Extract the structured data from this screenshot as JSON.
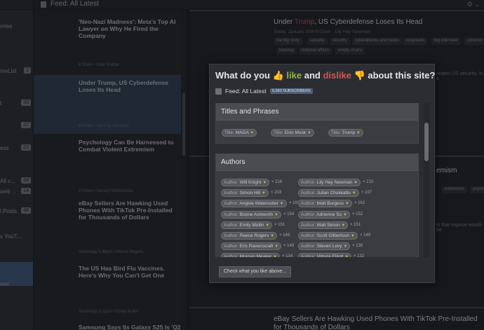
{
  "feed": {
    "title": "Feed: All Latest"
  },
  "sidebar": {
    "items": [
      {
        "label": "ories",
        "count": ""
      },
      {
        "label": "meList",
        "count": "2"
      },
      {
        "label": "t",
        "count": "33"
      },
      {
        "label": "",
        "count": "27"
      },
      {
        "label": "ess",
        "count": "22"
      },
      {
        "label": "All c...",
        "count": "34"
      },
      {
        "label": "web ...",
        "count": "14"
      },
      {
        "label": "l Posts",
        "count": "46"
      },
      {
        "label": "s YouT...",
        "count": ""
      },
      {
        "label": "ries",
        "count": ""
      }
    ]
  },
  "stories": [
    {
      "title": "'Neo-Nazi Madness': Meta's Top AI Lawyer on Why He Fired the Company",
      "meta": "6:20am • Kate Knibbe"
    },
    {
      "title": "Under Trump, US Cyberdefense Loses Its Head",
      "meta": "6:00am • Lily Hay Newman"
    },
    {
      "title": "Psychology Can Be Harnessed to Combat Violent Extremism",
      "meta": "6:00am • Harvey Whitehouse"
    },
    {
      "title": "eBay Sellers Are Hawking Used Phones With TikTok Pre-Installed for Thousands of Dollars",
      "meta": "Yesterday 5:46pm • Reece Rogers"
    },
    {
      "title": "The US Has Bird Flu Vaccines. Here's Why You Can't Get One",
      "meta": "Yesterday 2:11pm • Emily Mullin"
    },
    {
      "title": "Samsung Says Its Galaxy S25 Is 'Q2",
      "meta": ""
    }
  ],
  "pane": {
    "title_pre": "Under ",
    "title_red": "Trump",
    "title_post": ", US Cyberdefense Loses Its Head",
    "meta": "Today, January 20th 6:00am · Lily Hay Newman",
    "tags": [
      "the big story",
      "security",
      "security",
      "cyberattacks and hacks",
      "longreads",
      "big interview",
      "cyberse",
      "hacking",
      "national affairs",
      "empty chairs"
    ],
    "text1": "reaten US security. In a",
    "story2_suffix": "emism",
    "story2_tags": [
      "extremism",
      "psych"
    ],
    "text2": "ts that expose would-be",
    "story3_title": "eBay Sellers Are Hawking Used Phones With TikTok Pre-Installed for Thousands of Dollars"
  },
  "modal": {
    "title_1": "What do you ",
    "title_like": "like",
    "title_and": " and ",
    "title_dislike": "dislike",
    "title_2": " about this site?",
    "feed_name": "Feed: All Latest",
    "subscribers": "5,583 SUBSCRIBERS",
    "section_titles": "Titles and Phrases",
    "section_authors": "Authors",
    "titles": [
      {
        "key": "Title:",
        "value": "MAGA"
      },
      {
        "key": "Title:",
        "value": "Elon Musk"
      },
      {
        "key": "Title:",
        "value": "Trump"
      }
    ],
    "authors": [
      {
        "key": "Author:",
        "value": "Will Knight",
        "count": "× 216"
      },
      {
        "key": "Author:",
        "value": "Lily Hay Newman",
        "count": "× 210"
      },
      {
        "key": "Author:",
        "value": "Simon Hill",
        "count": "× 203"
      },
      {
        "key": "Author:",
        "value": "Julian Chokkattu",
        "count": "× 197"
      },
      {
        "key": "Author:",
        "value": "Angela Watercutter",
        "count": "× 193"
      },
      {
        "key": "Author:",
        "value": "Matt Burgess",
        "count": "× 162"
      },
      {
        "key": "Author:",
        "value": "Boone Ashworth",
        "count": "× 154"
      },
      {
        "key": "Author:",
        "value": "Adrienne So",
        "count": "× 152"
      },
      {
        "key": "Author:",
        "value": "Emily Mullin",
        "count": "× 151"
      },
      {
        "key": "Author:",
        "value": "Matt Simon",
        "count": "× 151"
      },
      {
        "key": "Author:",
        "value": "Reece Rogers",
        "count": "× 149"
      },
      {
        "key": "Author:",
        "value": "Scott Gilbertson",
        "count": "× 149"
      },
      {
        "key": "Author:",
        "value": "Eric Ravenscraft",
        "count": "× 149"
      },
      {
        "key": "Author:",
        "value": "Steven Levy",
        "count": "× 138"
      },
      {
        "key": "Author:",
        "value": "Morgan Meaker",
        "count": "× 134"
      },
      {
        "key": "Author:",
        "value": "Vittoria Elliott",
        "count": "× 132"
      }
    ],
    "button": "Check what you like above..."
  },
  "colors": {
    "like": "#8fb34b",
    "dislike": "#d9534f",
    "accent": "#3a5371"
  }
}
